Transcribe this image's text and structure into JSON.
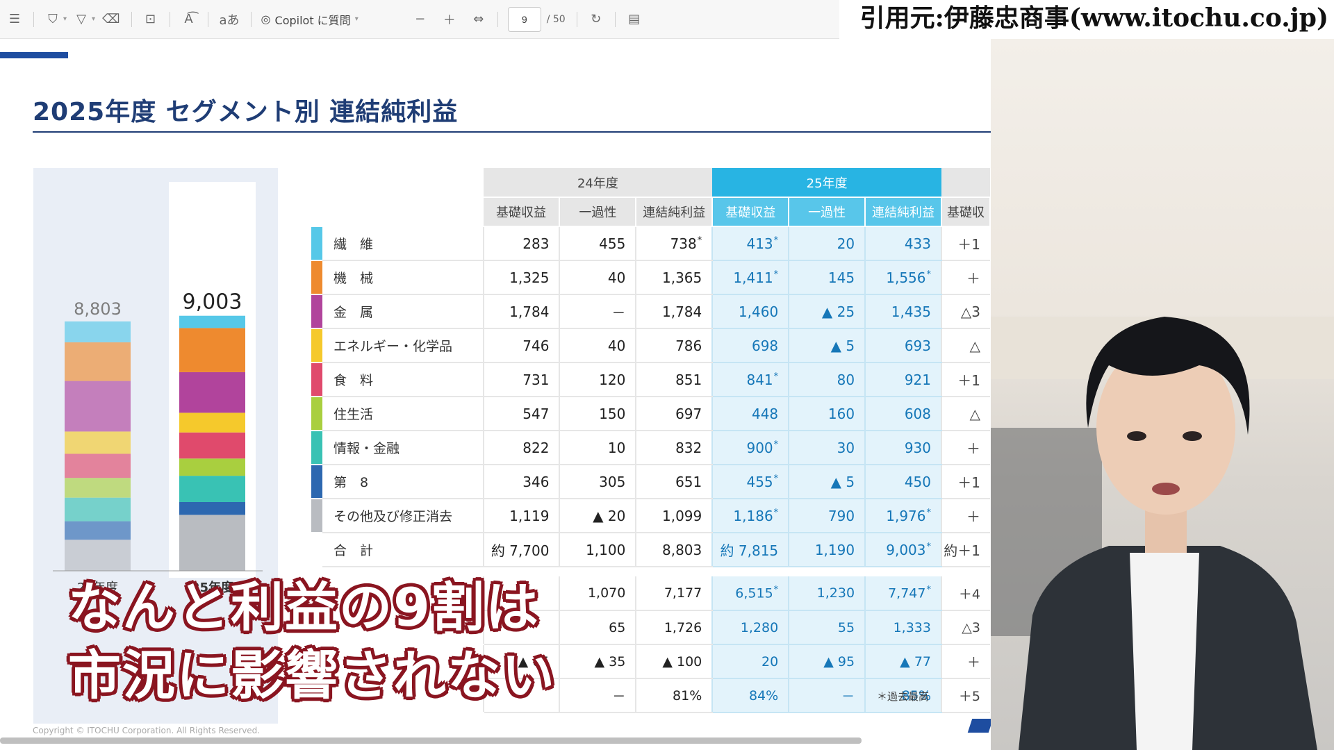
{
  "toolbar": {
    "copilot_label": "Copilot に質問",
    "page_current": "9",
    "page_total": "/ 50",
    "icons": [
      "menu-icon",
      "highlight-icon",
      "filter-icon",
      "eraser-icon",
      "textbox-icon",
      "read-aloud-icon",
      "translate-icon",
      "copilot-icon",
      "zoom-out-icon",
      "zoom-in-icon",
      "fit-width-icon",
      "rotate-icon",
      "page-view-icon"
    ]
  },
  "citation": "引用元:伊藤忠商事(www.itochu.co.jp)",
  "slide": {
    "title": "2025年度 セグメント別 連結純利益",
    "footnote": "＊過去最高",
    "copyright": "Copyright © ITOCHU Corporation. All Rights Reserved."
  },
  "chart_data": {
    "type": "bar",
    "stacked": true,
    "categories": [
      "24年度",
      "25年度"
    ],
    "totals": [
      "8,803",
      "9,003"
    ],
    "total_values": [
      8803,
      9003
    ],
    "series": [
      {
        "name": "繊維",
        "values": [
          738,
          433
        ],
        "color": "#56c8e8"
      },
      {
        "name": "機械",
        "values": [
          1365,
          1556
        ],
        "color": "#ee8a2f"
      },
      {
        "name": "金属",
        "values": [
          1784,
          1435
        ],
        "color": "#b1449c"
      },
      {
        "name": "エネルギー・化学品",
        "values": [
          786,
          693
        ],
        "color": "#f5c92c"
      },
      {
        "name": "食料",
        "values": [
          851,
          921
        ],
        "color": "#e04a6c"
      },
      {
        "name": "住生活",
        "values": [
          697,
          608
        ],
        "color": "#a9cf3f"
      },
      {
        "name": "情報・金融",
        "values": [
          832,
          930
        ],
        "color": "#39c2b4"
      },
      {
        "name": "第8",
        "values": [
          651,
          450
        ],
        "color": "#2d68b0"
      },
      {
        "name": "その他及び修正消去",
        "values": [
          1099,
          1976
        ],
        "color": "#b9bcc1"
      }
    ]
  },
  "table": {
    "year24_label": "24年度",
    "year25_label": "25年度",
    "headers": [
      "基礎収益",
      "一過性",
      "連結純利益",
      "基礎収益",
      "一過性",
      "連結純利益",
      "基礎収"
    ],
    "rows": [
      {
        "name": "繊　維",
        "color": "#56c8e8",
        "cells": [
          "283",
          "455",
          "738",
          "413",
          "20",
          "433",
          "＋1"
        ],
        "star": [
          false,
          false,
          true,
          true,
          false,
          false,
          false
        ]
      },
      {
        "name": "機　械",
        "color": "#ee8a2f",
        "cells": [
          "1,325",
          "40",
          "1,365",
          "1,411",
          "145",
          "1,556",
          "＋"
        ],
        "star": [
          false,
          false,
          false,
          true,
          false,
          true,
          false
        ]
      },
      {
        "name": "金　属",
        "color": "#b1449c",
        "cells": [
          "1,784",
          "－",
          "1,784",
          "1,460",
          "▲ 25",
          "1,435",
          "△3"
        ],
        "star": [
          false,
          false,
          false,
          false,
          false,
          false,
          false
        ]
      },
      {
        "name": "エネルギー・化学品",
        "color": "#f5c92c",
        "cells": [
          "746",
          "40",
          "786",
          "698",
          "▲ 5",
          "693",
          "△"
        ],
        "star": [
          false,
          false,
          false,
          false,
          false,
          false,
          false
        ]
      },
      {
        "name": "食　料",
        "color": "#e04a6c",
        "cells": [
          "731",
          "120",
          "851",
          "841",
          "80",
          "921",
          "＋1"
        ],
        "star": [
          false,
          false,
          false,
          true,
          false,
          false,
          false
        ]
      },
      {
        "name": "住生活",
        "color": "#a9cf3f",
        "cells": [
          "547",
          "150",
          "697",
          "448",
          "160",
          "608",
          "△"
        ],
        "star": [
          false,
          false,
          false,
          false,
          false,
          false,
          false
        ]
      },
      {
        "name": "情報・金融",
        "color": "#39c2b4",
        "cells": [
          "822",
          "10",
          "832",
          "900",
          "30",
          "930",
          "＋"
        ],
        "star": [
          false,
          false,
          false,
          true,
          false,
          false,
          false
        ]
      },
      {
        "name": "第　8",
        "color": "#2d68b0",
        "cells": [
          "346",
          "305",
          "651",
          "455",
          "▲ 5",
          "450",
          "＋1"
        ],
        "star": [
          false,
          false,
          false,
          true,
          false,
          false,
          false
        ]
      },
      {
        "name": "その他及び修正消去",
        "color": "#b9bcc1",
        "cells": [
          "1,119",
          "▲ 20",
          "1,099",
          "1,186",
          "790",
          "1,976",
          "＋"
        ],
        "star": [
          false,
          false,
          false,
          true,
          false,
          true,
          false
        ]
      },
      {
        "name": "合　計",
        "color": "#ffffff",
        "cells": [
          "約 7,700",
          "1,100",
          "8,803",
          "約 7,815",
          "1,190",
          "9,003",
          "約＋1"
        ],
        "star": [
          false,
          false,
          false,
          false,
          false,
          true,
          false
        ]
      }
    ],
    "extra_rows": [
      {
        "cells": [
          "",
          "1,070",
          "7,177",
          "6,515",
          "1,230",
          "7,747",
          "＋4"
        ],
        "star": [
          false,
          false,
          false,
          true,
          false,
          true,
          false
        ]
      },
      {
        "cells": [
          "",
          "65",
          "1,726",
          "1,280",
          "55",
          "1,333",
          "△3"
        ],
        "star": [
          false,
          false,
          false,
          false,
          false,
          false,
          false
        ]
      },
      {
        "cells": [
          "▲ 65",
          "▲ 35",
          "▲ 100",
          "20",
          "▲ 95",
          "▲ 77",
          "＋"
        ],
        "star": [
          false,
          false,
          false,
          false,
          false,
          false,
          false
        ]
      },
      {
        "cells": [
          "",
          "－",
          "81%",
          "84%",
          "－",
          "85%",
          "＋5"
        ],
        "star": [
          false,
          false,
          false,
          false,
          false,
          false,
          false
        ]
      }
    ]
  },
  "caption": {
    "line1": "なんと利益の9割は",
    "line2": "市況に影響されない"
  }
}
